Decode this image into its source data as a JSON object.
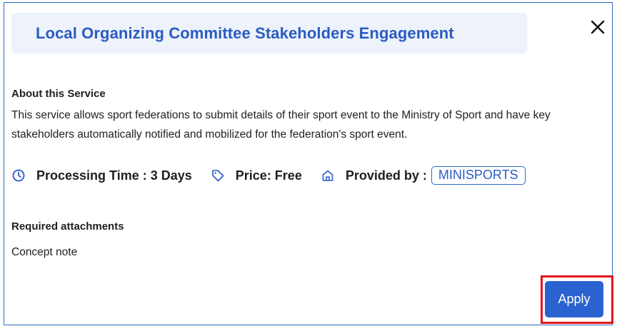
{
  "modal": {
    "title": "Local Organizing Committee Stakeholders Engagement",
    "close_icon": "close-icon"
  },
  "about": {
    "heading": "About this Service",
    "description": "This service allows sport federations to submit details of their sport event to the Ministry of Sport and have key stakeholders automatically notified and mobilized for the federation's sport event."
  },
  "meta": {
    "processing_time": "Processing Time : 3 Days",
    "price": "Price: Free",
    "provided_by_label": "Provided by :",
    "provider": "MINISPORTS",
    "icons": [
      "clock-icon",
      "price-tag-icon",
      "home-icon"
    ]
  },
  "attachments": {
    "heading": "Required attachments",
    "items": [
      "Concept note"
    ]
  },
  "actions": {
    "apply_label": "Apply"
  },
  "colors": {
    "accent": "#2a5cc1",
    "title_bg": "#edf2fb",
    "apply_bg": "#2a63d0",
    "highlight": "#e3161b"
  }
}
